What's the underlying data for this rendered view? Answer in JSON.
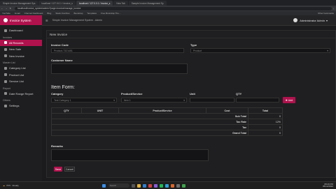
{
  "browser": {
    "tabs": [
      "Simple Invoice Management Sys",
      "localhost / 127.0.0.1 / invoice_s",
      "localhost / 127.0.0.1 / invoice_s",
      "New Tab",
      "Sample Invoice Management Sy"
    ],
    "url": "localhost/invoice_system/admin/?page=invoice/manage_invoice",
    "bookmarks": [
      "YouTube",
      "Gmail",
      "Channel Dashboard",
      "Blog",
      "Stack Overflow",
      "Bootstrap",
      "Templates",
      "Free Bootstrap The...",
      "Other bookmarks"
    ]
  },
  "sidebar": {
    "brand": "Invoice System",
    "items": [
      {
        "label": "Dashboard",
        "section": ""
      },
      {
        "label": "All Records",
        "section": "Invoices",
        "active": true
      },
      {
        "label": "New Sale",
        "section": ""
      },
      {
        "label": "New Invoice",
        "section": ""
      },
      {
        "label": "Category List",
        "section": "Master List"
      },
      {
        "label": "Product List",
        "section": ""
      },
      {
        "label": "Service List",
        "section": ""
      },
      {
        "label": "Date Range Report",
        "section": "Report"
      },
      {
        "label": "Settings",
        "section": "Others"
      }
    ]
  },
  "topbar": {
    "title": "Simple Invoice Management System - Admin",
    "user": "Administrator Admin"
  },
  "card": {
    "title": "New Invoice",
    "invoice_code_label": "Invoice Code",
    "invoice_code_value": "Product-7321451",
    "type_label": "Type",
    "type_value": "Product",
    "customer_label": "Customer Name",
    "item_form_title": "Item Form:",
    "category_label": "Category",
    "category_value": "Test Category 1",
    "product_label": "Product/Service",
    "product_value": "Item 1",
    "unit_label": "Unit",
    "qty_label": "QTY",
    "add_button": "Add",
    "table": {
      "headers": [
        "QTY",
        "UNIT",
        "Product/Service",
        "Cost",
        "Total"
      ],
      "summary": [
        {
          "label": "Sub Total",
          "value": "0"
        },
        {
          "label": "Tax Rate",
          "value": "12%"
        },
        {
          "label": "Tax",
          "value": "0"
        },
        {
          "label": "Grand Total",
          "value": "0"
        }
      ]
    },
    "remarks_label": "Remarks",
    "save_button": "Save",
    "cancel_button": "Cancel"
  },
  "taskbar": {
    "weather_temp": "73°F",
    "weather_desc": "Cloudy",
    "search": "Search",
    "time": "08:29 PM",
    "date": "05/12/2022"
  }
}
